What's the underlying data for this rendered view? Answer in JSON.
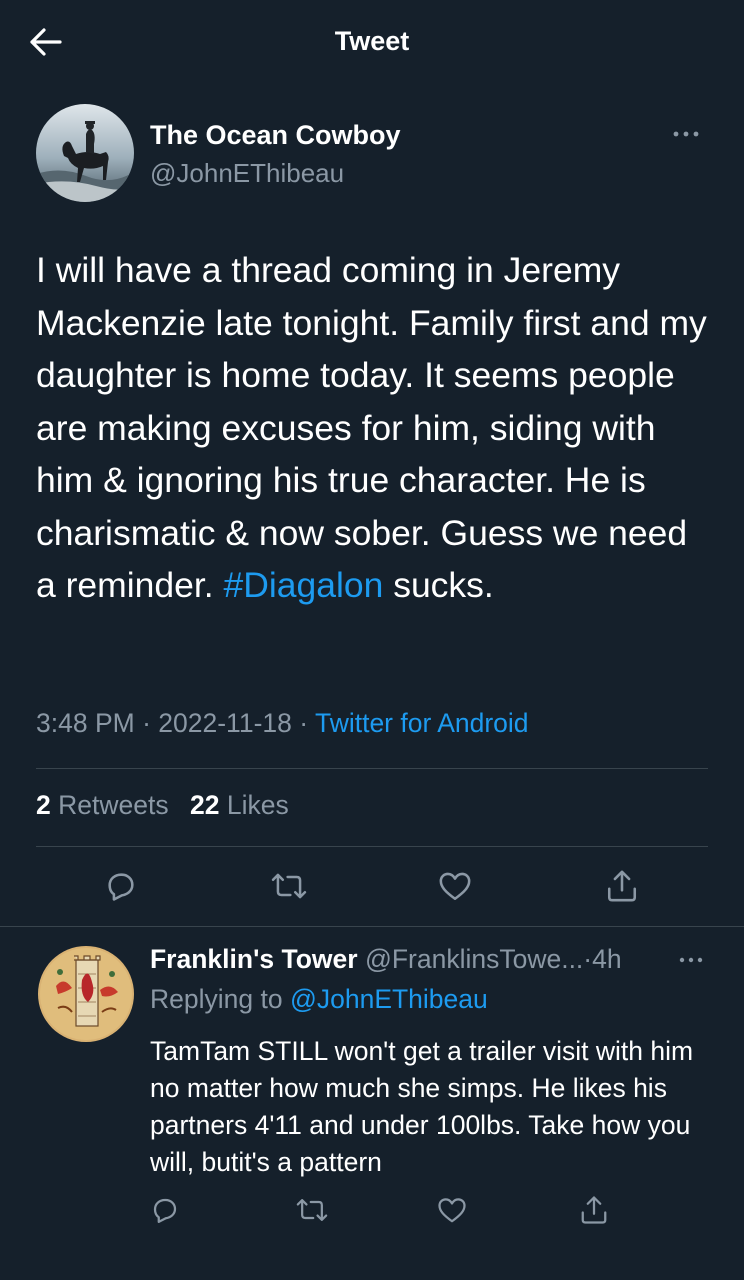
{
  "header": {
    "title": "Tweet",
    "back_icon": "arrow-left-icon"
  },
  "tweet": {
    "author": {
      "name": "The Ocean Cowboy",
      "handle": "@JohnEThibeau"
    },
    "text_before": "I will have a thread coming in Jeremy Mackenzie late tonight. Family first and my daughter is home today. It seems people are making excuses for him, siding with him & ignoring his true character. He is charismatic & now sober. Guess we need a reminder. ",
    "hashtag": "#Diagalon",
    "text_after": " sucks.",
    "time": "3:48 PM",
    "separator": "·",
    "date": "2022-11-18",
    "source": "Twitter for Android",
    "retweets_count": "2",
    "retweets_label": "Retweets",
    "likes_count": "22",
    "likes_label": "Likes"
  },
  "reply": {
    "name": "Franklin's Tower",
    "handle": "@FranklinsTowe...",
    "separator": "·",
    "time": "4h",
    "replying_prefix": "Replying to",
    "replying_to": "@JohnEThibeau",
    "text": "TamTam STILL won't get a trailer visit with him no matter how much she simps. He likes his partners 4'11 and under 100lbs. Take how you will, butit's a pattern"
  },
  "colors": {
    "background": "#15202b",
    "text": "#ffffff",
    "secondary": "#8b98a5",
    "accent": "#1d9bf0",
    "divider": "#38444d"
  },
  "icons": [
    "arrow-left-icon",
    "more-dots-icon",
    "reply-icon",
    "retweet-icon",
    "like-heart-icon",
    "share-icon"
  ]
}
